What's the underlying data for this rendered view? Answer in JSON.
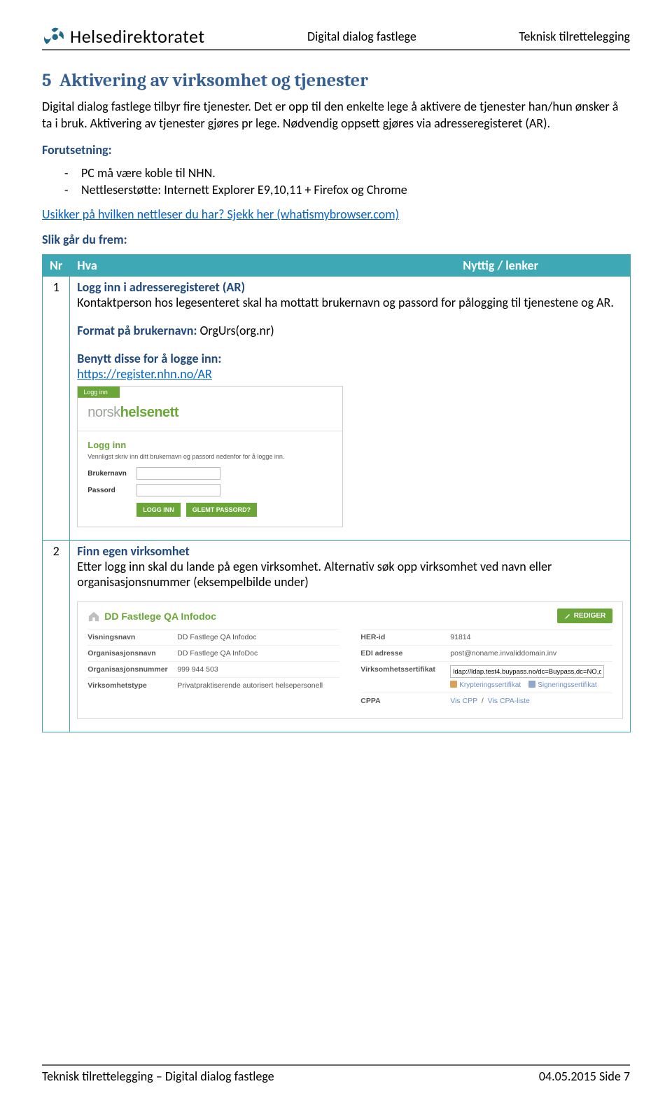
{
  "header": {
    "brand": "Helsedirektoratet",
    "center": "Digital dialog fastlege",
    "right": "Teknisk tilrettelegging"
  },
  "section": {
    "number": "5",
    "title": "Aktivering av virksomhet og tjenester",
    "intro": "Digital dialog fastlege tilbyr fire tjenester. Det er opp til den enkelte lege å aktivere de tjenester han/hun ønsker å ta i bruk. Aktivering av tjenester gjøres pr lege. Nødvendig oppsett gjøres via adresseregisteret (AR).",
    "forutsetning_label": "Forutsetning:",
    "forutsetning_items": [
      "PC må være koble til NHN.",
      "Nettleserstøtte: Internett Explorer E9,10,11 + Firefox og Chrome"
    ],
    "usikker_link": "Usikker på hvilken nettleser du har? Sjekk her (whatismybrowser.com)",
    "slik_label": "Slik går du frem:"
  },
  "table": {
    "head": {
      "nr": "Nr",
      "hva": "Hva",
      "lenker": "Nyttig / lenker"
    },
    "rows": [
      {
        "nr": "1",
        "title": "Logg inn i adresseregisteret (AR)",
        "body": "Kontaktperson hos legesenteret skal ha mottatt brukernavn og passord for pålogging til tjenestene og AR.",
        "format_label": "Format på brukernavn:",
        "format_value": "OrgUrs(org.nr)",
        "benytt": "Benytt disse for å logge inn:",
        "url": "https://register.nhn.no/AR"
      },
      {
        "nr": "2",
        "title": "Finn egen virksomhet",
        "body": "Etter logg inn skal du lande på egen virksomhet. Alternativ søk opp virksomhet ved navn eller organisasjonsnummer (eksempelbilde under)"
      }
    ]
  },
  "login_shot": {
    "tab": "Logg inn",
    "brand1": "norsk",
    "brand2": "helsenett",
    "title": "Logg inn",
    "instr": "Vennligst skriv inn ditt brukernavn og passord nedenfor for å logge inn.",
    "label_user": "Brukernavn",
    "label_pass": "Passord",
    "btn_login": "LOGG INN",
    "btn_forgot": "GLEMT PASSORD?"
  },
  "virk_shot": {
    "title": "DD Fastlege QA Infodoc",
    "edit_btn": "REDIGER",
    "left": [
      {
        "k": "Visningsnavn",
        "v": "DD Fastlege QA Infodoc"
      },
      {
        "k": "Organisasjonsnavn",
        "v": "DD Fastlege QA InfoDoc"
      },
      {
        "k": "Organisasjonsnummer",
        "v": "999 944 503"
      },
      {
        "k": "Virksomhetstype",
        "v": "Privatpraktiserende autorisert helsepersonell"
      }
    ],
    "right": {
      "her_k": "HER-id",
      "her_v": "91814",
      "edi_k": "EDI adresse",
      "edi_v": "post@noname.invaliddomain.inv",
      "sert_k": "Virksomhetssertifikat",
      "sert_ldap": "ldap://ldap.test4.buypass.no/dc=Buypass,dc=NO,d",
      "sert_link1": "Krypteringssertifikat",
      "sert_link2": "Signeringssertifikat",
      "cppa_k": "CPPA",
      "cppa_v1": "Vis CPP",
      "cppa_v2": "Vis CPA-liste"
    }
  },
  "footer": {
    "left": "Teknisk tilrettelegging – Digital dialog fastlege",
    "right": "04.05.2015 Side 7"
  }
}
